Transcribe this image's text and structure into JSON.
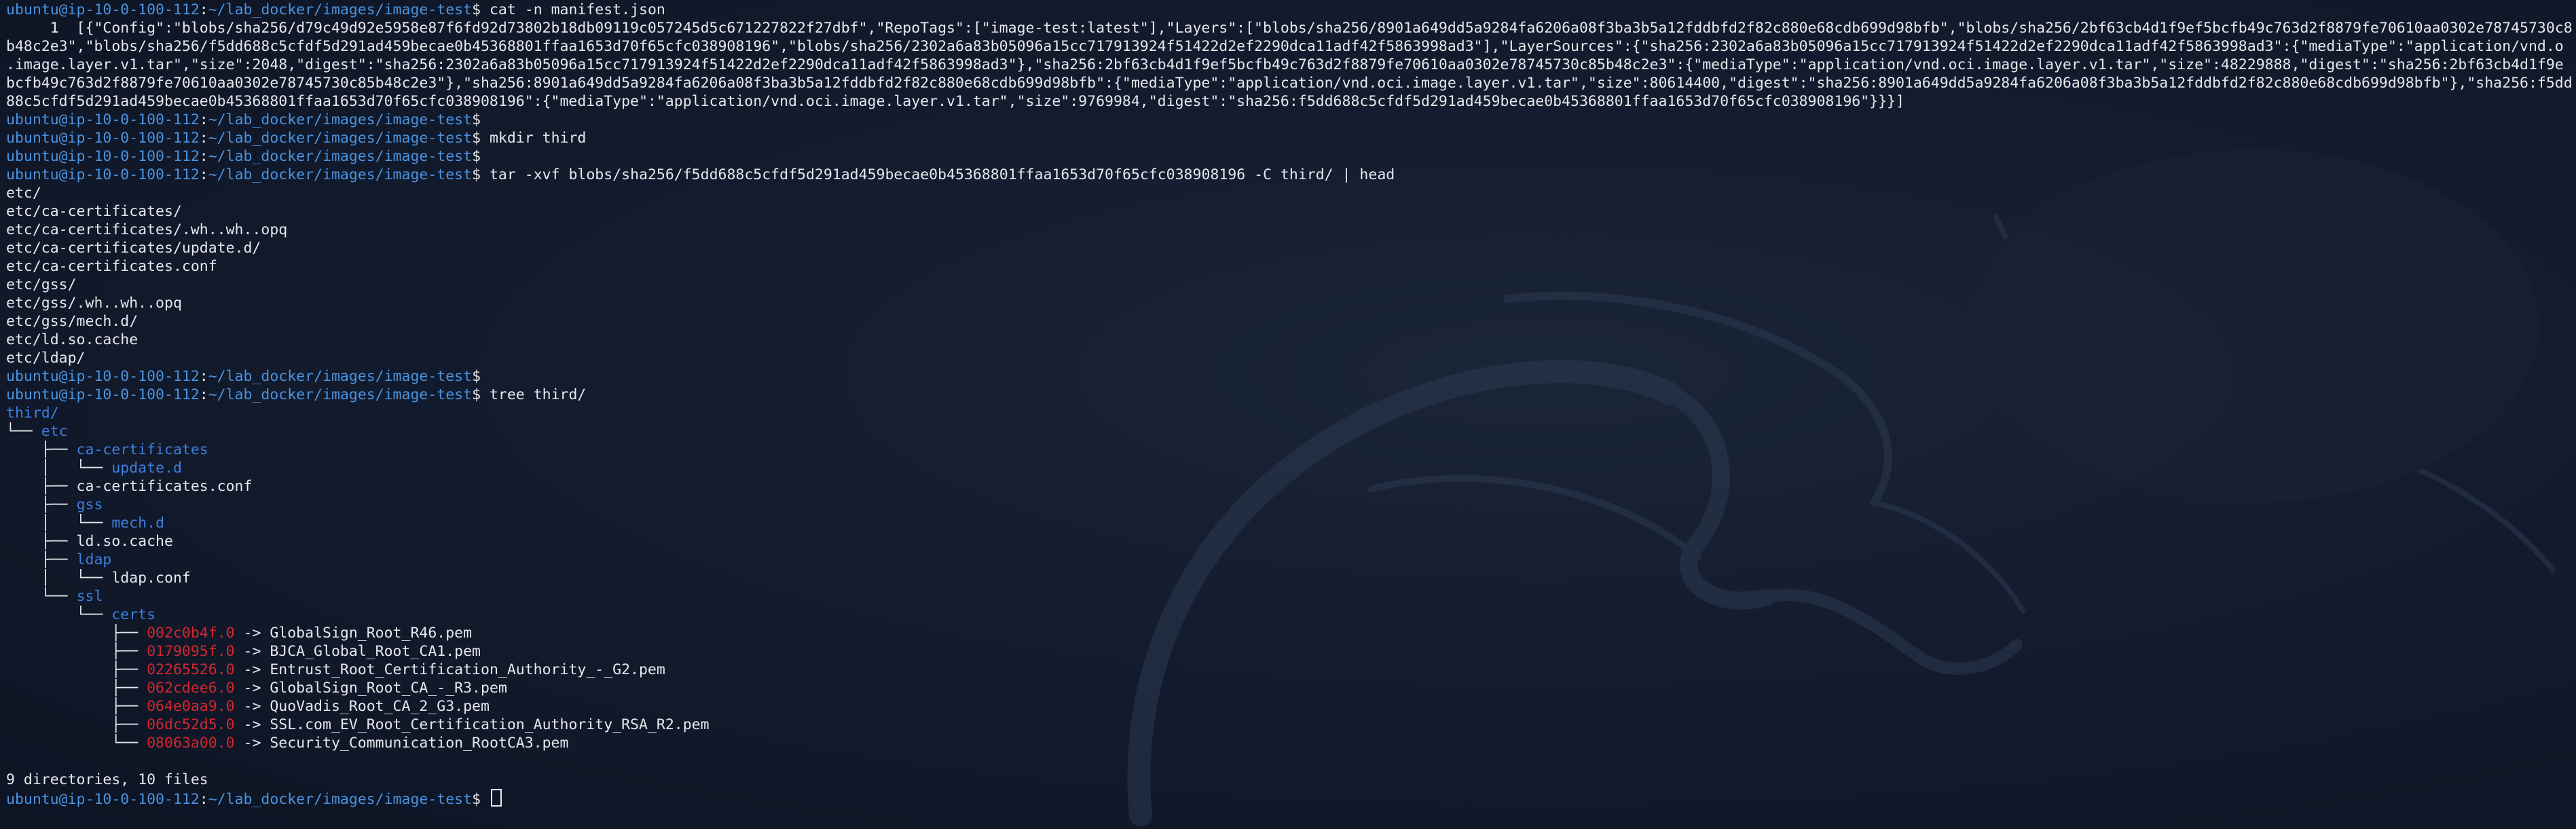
{
  "prompt": {
    "user_host": "ubuntu@ip-10-0-100-112",
    "colon": ":",
    "path": "~/lab_docker/images/image-test",
    "symbol": "$"
  },
  "manifest_lines": [
    "     1  [{\"Config\":\"blobs/sha256/d79c49d92e5958e87f6fd92d73802b18db09119c057245d5c671227822f27dbf\",\"RepoTags\":[\"image-test:latest\"],\"Layers\":[\"blobs/sha256/8901a649dd5a9284fa6206a08f3ba3b5a12fddbfd2f82c880e68cdb699d98bfb\",\"blobs/sha256/2bf63cb4d1f9ef5bcfb49c763d2f8879fe70610aa0302e78745730c8",
    "b48c2e3\",\"blobs/sha256/f5dd688c5cfdf5d291ad459becae0b45368801ffaa1653d70f65cfc038908196\",\"blobs/sha256/2302a6a83b05096a15cc717913924f51422d2ef2290dca11adf42f5863998ad3\"],\"LayerSources\":{\"sha256:2302a6a83b05096a15cc717913924f51422d2ef2290dca11adf42f5863998ad3\":{\"mediaType\":\"application/vnd.o",
    ".image.layer.v1.tar\",\"size\":2048,\"digest\":\"sha256:2302a6a83b05096a15cc717913924f51422d2ef2290dca11adf42f5863998ad3\"},\"sha256:2bf63cb4d1f9ef5bcfb49c763d2f8879fe70610aa0302e78745730c85b48c2e3\":{\"mediaType\":\"application/vnd.oci.image.layer.v1.tar\",\"size\":48229888,\"digest\":\"sha256:2bf63cb4d1f9e",
    "bcfb49c763d2f8879fe70610aa0302e78745730c85b48c2e3\"},\"sha256:8901a649dd5a9284fa6206a08f3ba3b5a12fddbfd2f82c880e68cdb699d98bfb\":{\"mediaType\":\"application/vnd.oci.image.layer.v1.tar\",\"size\":80614400,\"digest\":\"sha256:8901a649dd5a9284fa6206a08f3ba3b5a12fddbfd2f82c880e68cdb699d98bfb\"},\"sha256:f5dd",
    "88c5cfdf5d291ad459becae0b45368801ffaa1653d70f65cfc038908196\":{\"mediaType\":\"application/vnd.oci.image.layer.v1.tar\",\"size\":9769984,\"digest\":\"sha256:f5dd688c5cfdf5d291ad459becae0b45368801ffaa1653d70f65cfc038908196\"}}}]"
  ],
  "commands": {
    "cat_manifest": "cat -n manifest.json",
    "mkdir": "mkdir third",
    "tar": "tar -xvf blobs/sha256/f5dd688c5cfdf5d291ad459becae0b45368801ffaa1653d70f65cfc038908196 -C third/ | head",
    "tree": "tree third/"
  },
  "tar_output": [
    "etc/",
    "etc/ca-certificates/",
    "etc/ca-certificates/.wh..wh..opq",
    "etc/ca-certificates/update.d/",
    "etc/ca-certificates.conf",
    "etc/gss/",
    "etc/gss/.wh..wh..opq",
    "etc/gss/mech.d/",
    "etc/ld.so.cache",
    "etc/ldap/"
  ],
  "tree": {
    "root": "third/",
    "etc_prefix": "└── ",
    "etc": "etc",
    "ca_certificates_prefix": "    ├── ",
    "ca_certificates": "ca-certificates",
    "update_d_prefix": "    │   └── ",
    "update_d": "update.d",
    "ca_conf": "    ├── ca-certificates.conf",
    "gss_prefix": "    ├── ",
    "gss": "gss",
    "mech_d_prefix": "    │   └── ",
    "mech_d": "mech.d",
    "ld_cache": "    ├── ld.so.cache",
    "ldap_prefix": "    ├── ",
    "ldap": "ldap",
    "ldap_conf": "    │   └── ldap.conf",
    "ssl_prefix": "    └── ",
    "ssl": "ssl",
    "certs_prefix": "        └── ",
    "certs": "certs",
    "links": [
      {
        "prefix": "            ├── ",
        "name": "002c0b4f.0",
        "target": " -> GlobalSign_Root_R46.pem"
      },
      {
        "prefix": "            ├── ",
        "name": "0179095f.0",
        "target": " -> BJCA_Global_Root_CA1.pem"
      },
      {
        "prefix": "            ├── ",
        "name": "02265526.0",
        "target": " -> Entrust_Root_Certification_Authority_-_G2.pem"
      },
      {
        "prefix": "            ├── ",
        "name": "062cdee6.0",
        "target": " -> GlobalSign_Root_CA_-_R3.pem"
      },
      {
        "prefix": "            ├── ",
        "name": "064e0aa9.0",
        "target": " -> QuoVadis_Root_CA_2_G3.pem"
      },
      {
        "prefix": "            ├── ",
        "name": "06dc52d5.0",
        "target": " -> SSL.com_EV_Root_Certification_Authority_RSA_R2.pem"
      },
      {
        "prefix": "            └── ",
        "name": "08063a00.0",
        "target": " -> Security_Communication_RootCA3.pem"
      }
    ],
    "summary": "9 directories, 10 files"
  },
  "colors": {
    "background": "#10182a",
    "prompt": "#4a93e0",
    "directory": "#3d7fe0",
    "broken_link": "#d2272f",
    "text": "#e6e8ec"
  }
}
